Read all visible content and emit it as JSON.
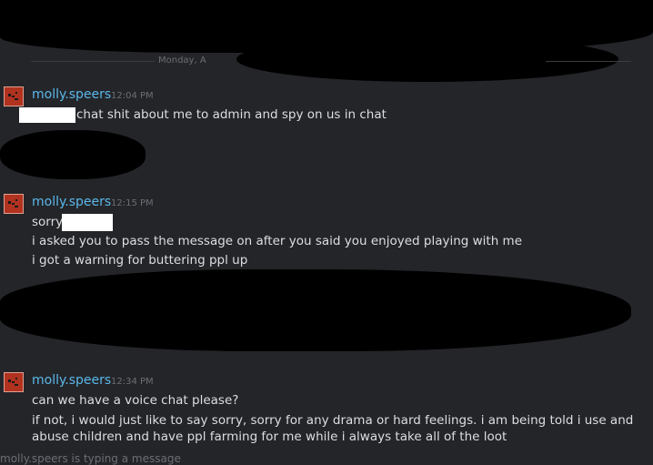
{
  "chat": {
    "divider_label": "Monday, A",
    "typing_indicator": "molly.speers is typing a message",
    "groups": [
      {
        "author": "molly.speers",
        "time": "12:04 PM",
        "lines": [
          "chat shit about me to admin and spy on us in chat"
        ]
      },
      {
        "author": "molly.speers",
        "time": "12:15 PM",
        "lines": [
          "sorry",
          "i asked you to pass the message on after you said you enjoyed playing with me",
          "i got a warning for buttering ppl up"
        ]
      },
      {
        "author": "molly.speers",
        "time": "12:34 PM",
        "lines": [
          "can we have a voice chat please?",
          "if not, i would just like to say sorry, sorry for any drama or hard feelings. i am being told i use and",
          "abuse children and have ppl farming for me while i always take all of the loot"
        ]
      }
    ]
  },
  "colors": {
    "background": "#242529",
    "author_name": "#5ab8ea",
    "message_text": "#dcdedf",
    "timestamp": "#6b6e74",
    "avatar": "#b0321f"
  }
}
